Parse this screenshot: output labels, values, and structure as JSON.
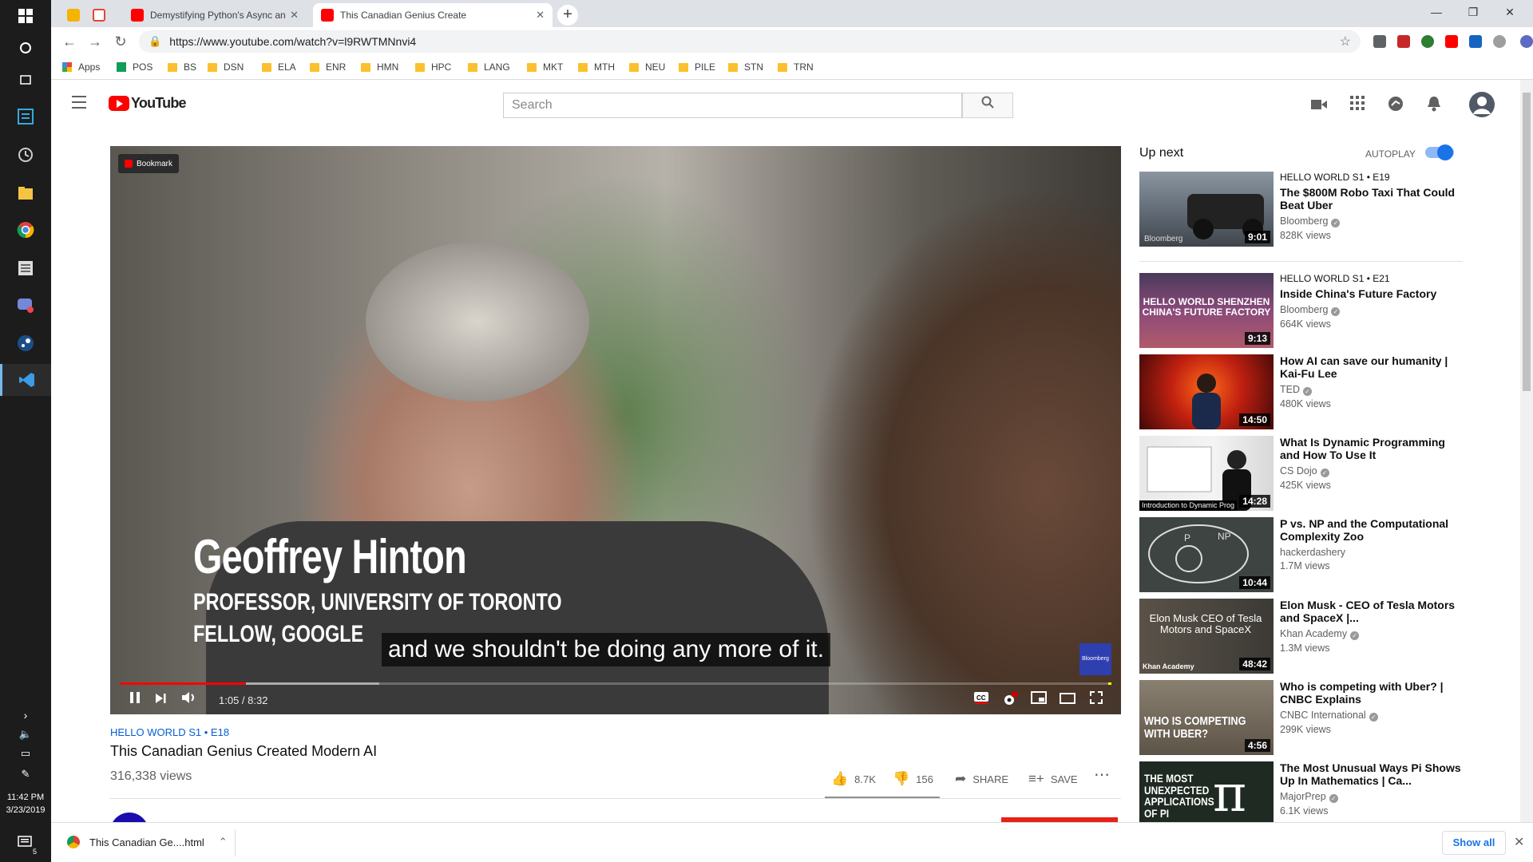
{
  "taskbar": {
    "icons": [
      "windows-start-icon",
      "cortana-icon",
      "task-view-icon",
      "editor-icon",
      "clock-app-icon",
      "file-explorer-icon",
      "chrome-icon",
      "notes-icon",
      "discord-icon",
      "steam-icon",
      "vscode-icon"
    ],
    "time": "11:42 PM",
    "date": "3/23/2019",
    "notification_count": "5"
  },
  "browser": {
    "tabs": [
      {
        "title": "Demystifying Python's Async and",
        "favicon": "#f4b400"
      },
      {
        "title": "",
        "favicon": "#ea4335"
      },
      {
        "title": "Demystifying Python's Async and",
        "favicon": "#ff0000"
      },
      {
        "title": "This Canadian Genius Create",
        "favicon": "#ff0000",
        "active": true
      }
    ],
    "url": "https://www.youtube.com/watch?v=l9RWTMNnvi4",
    "bookmarks": [
      "Apps",
      "POS",
      "BS",
      "DSN",
      "ELA",
      "ENR",
      "HMN",
      "HPC",
      "LANG",
      "MKT",
      "MTH",
      "NEU",
      "PILE",
      "STN",
      "TRN"
    ]
  },
  "youtube": {
    "logo_text": "YouTube",
    "search_placeholder": "Search"
  },
  "player": {
    "bookmark_badge": "Bookmark",
    "lower_third_name": "Geoffrey Hinton",
    "lower_third_role1": "PROFESSOR, UNIVERSITY OF TORONTO",
    "lower_third_role2": "FELLOW, GOOGLE",
    "caption": "and we shouldn't be doing any more of it.",
    "brand_logo": "Bloomberg",
    "time_display": "1:05 / 8:32",
    "progress_fraction": 0.127
  },
  "video": {
    "series": "HELLO WORLD  S1 • E18",
    "title": "This Canadian Genius Created Modern AI",
    "views": "316,338 views",
    "likes": "8.7K",
    "dislikes": "156",
    "share_label": "SHARE",
    "save_label": "SAVE"
  },
  "sidebar": {
    "up_next_label": "Up next",
    "autoplay_label": "AUTOPLAY",
    "autoplay_on": true,
    "items": [
      {
        "series": "HELLO WORLD  S1 • E19",
        "title": "The $800M Robo Taxi That Could Beat Uber",
        "channel": "Bloomberg",
        "views": "828K views",
        "duration": "9:01",
        "thumb_text": "Bloomberg"
      },
      {
        "series": "HELLO WORLD  S1 • E21",
        "title": "Inside China's Future Factory",
        "channel": "Bloomberg",
        "views": "664K views",
        "duration": "9:13",
        "thumb_text": "HELLO WORLD SHENZHEN CHINA'S FUTURE FACTORY"
      },
      {
        "series": "",
        "title": "How AI can save our humanity | Kai-Fu Lee",
        "channel": "TED",
        "views": "480K views",
        "duration": "14:50",
        "thumb_text": ""
      },
      {
        "series": "",
        "title": "What Is Dynamic Programming and How To Use It",
        "channel": "CS Dojo",
        "views": "425K views",
        "duration": "14:28",
        "thumb_text": "Introduction to Dynamic Prog"
      },
      {
        "series": "",
        "title": "P vs. NP and the Computational Complexity Zoo",
        "channel": "hackerdashery",
        "views": "1.7M views",
        "duration": "10:44",
        "thumb_text": ""
      },
      {
        "series": "",
        "title": "Elon Musk - CEO of Tesla Motors and SpaceX |...",
        "channel": "Khan Academy",
        "views": "1.3M views",
        "duration": "48:42",
        "thumb_text": "Elon Musk CEO of Tesla Motors and SpaceX"
      },
      {
        "series": "",
        "title": "Who is competing with Uber? | CNBC Explains",
        "channel": "CNBC International",
        "views": "299K views",
        "duration": "4:56",
        "thumb_text": "WHO IS COMPETING WITH UBER?"
      },
      {
        "series": "",
        "title": "The Most Unusual Ways Pi Shows Up In Mathematics | Ca...",
        "channel": "MajorPrep",
        "views": "6.1K views",
        "duration": "",
        "thumb_text": "THE MOST UNEXPECTED APPLICATIONS OF PI"
      }
    ]
  },
  "downloads": {
    "file": "This Canadian Ge....html",
    "show_all": "Show all"
  }
}
